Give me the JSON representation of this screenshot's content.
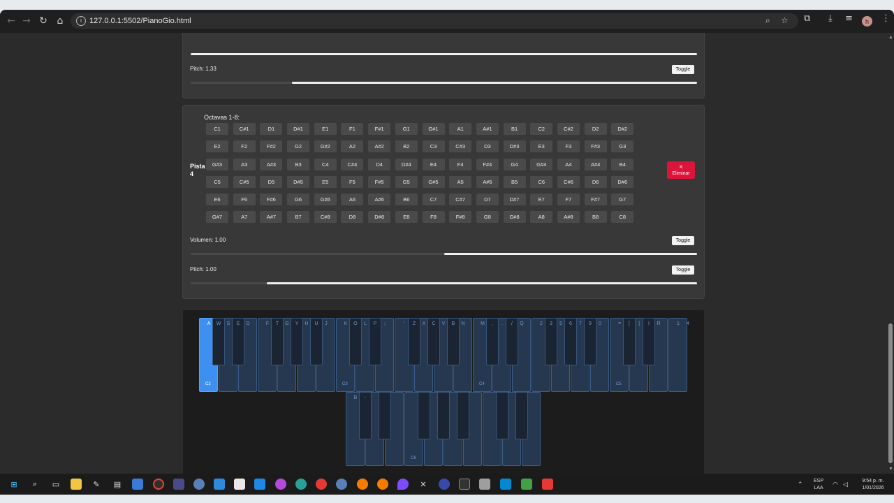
{
  "browser": {
    "url": "127.0.0.1:5502/PianoGio.html"
  },
  "top_panel": {
    "pitch_label": "Pitch: 1.33",
    "toggle_label": "Toggle",
    "pitch_fraction": 0.8
  },
  "track4": {
    "octaves_title": "Octavas 1-8:",
    "track_label": "Pista 4",
    "delete_icon": "×",
    "delete_label": "Eliminar",
    "notes": [
      "C1",
      "C#1",
      "D1",
      "D#1",
      "E1",
      "F1",
      "F#1",
      "G1",
      "G#1",
      "A1",
      "A#1",
      "B1",
      "C2",
      "C#2",
      "D2",
      "D#2",
      "E2",
      "F2",
      "F#2",
      "G2",
      "G#2",
      "A2",
      "A#2",
      "B2",
      "C3",
      "C#3",
      "D3",
      "D#3",
      "E3",
      "F3",
      "F#3",
      "G3",
      "G#3",
      "A3",
      "A#3",
      "B3",
      "C4",
      "C#4",
      "D4",
      "D#4",
      "E4",
      "F4",
      "F#4",
      "G4",
      "G#4",
      "A4",
      "A#4",
      "B4",
      "C5",
      "C#5",
      "D5",
      "D#5",
      "E5",
      "F5",
      "F#5",
      "G5",
      "G#5",
      "A5",
      "A#5",
      "B5",
      "C6",
      "C#6",
      "D6",
      "D#6",
      "E6",
      "F6",
      "F#6",
      "G6",
      "G#6",
      "A6",
      "A#6",
      "B6",
      "C7",
      "C#7",
      "D7",
      "D#7",
      "E7",
      "F7",
      "F#7",
      "G7",
      "G#7",
      "A7",
      "A#7",
      "B7",
      "C#8",
      "D8",
      "D#8",
      "E8",
      "F8",
      "F#8",
      "G8",
      "G#8",
      "A8",
      "A#8",
      "B8",
      "C8"
    ],
    "volume_label": "Volumen: 1.00",
    "volume_fraction": 0.5,
    "pitch_label": "Pitch: 1.00",
    "pitch_fraction": 0.85,
    "toggle_label": "Toggle"
  },
  "piano": {
    "row1_labels": [
      "A",
      "W",
      "S",
      "E",
      "D",
      "F",
      "T",
      "G",
      "Y",
      "H",
      "U",
      "J",
      "K",
      "O",
      "L",
      "P",
      ";",
      "'",
      "Z",
      "X",
      "C",
      "V",
      "B",
      "N",
      "M",
      ",",
      ".",
      "/",
      "Q",
      "2",
      "3",
      "5",
      "6",
      "7",
      "9",
      "0",
      "=",
      "[",
      "]",
      "I",
      "R",
      "1",
      "4"
    ],
    "octave_labels": [
      "C2",
      "C3",
      "C4",
      "C5",
      "C6"
    ],
    "row2_labels": [
      "B",
      "-"
    ],
    "active_key": "A"
  },
  "taskbar": {
    "lang": "ESP",
    "lang2": "LAA",
    "time": "9:54 p. m.",
    "date": "1/01/2026"
  },
  "colors": {
    "accent": "#3d8ff0",
    "danger": "#dc143c"
  }
}
